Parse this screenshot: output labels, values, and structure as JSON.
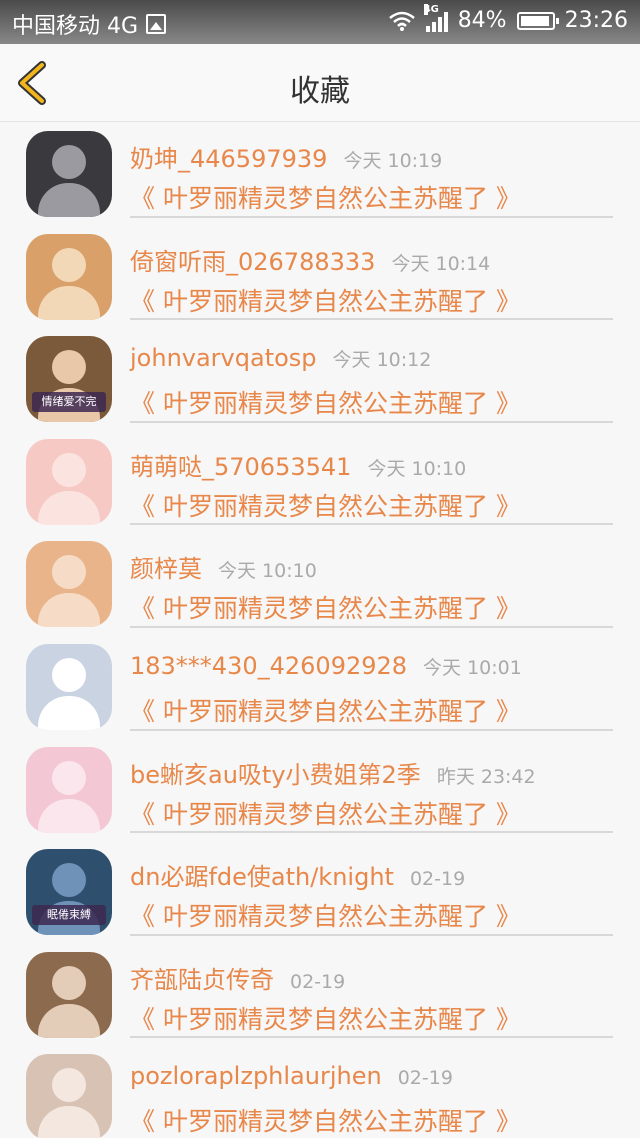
{
  "status_bar": {
    "carrier": "中国移动 4G",
    "network_badge": "4G",
    "battery": "84%",
    "time": "23:26"
  },
  "header": {
    "title": "收藏",
    "back_icon": "chevron-left-icon",
    "accent_color": "#f2b51c"
  },
  "colors": {
    "username": "#e8874a",
    "book_title": "#e8874a",
    "time": "#aaaaaa"
  },
  "favorites": [
    {
      "username": "奶坤_446597939",
      "time": "今天 10:19",
      "book": "《 叶罗丽精灵梦自然公主苏醒了 》",
      "avatar_bg": "#3a3a3e",
      "avatar_fg": "#9a9aa0",
      "avatar_text": ""
    },
    {
      "username": "倚窗听雨_026788333",
      "time": "今天 10:14",
      "book": "《 叶罗丽精灵梦自然公主苏醒了 》",
      "avatar_bg": "#d9a06a",
      "avatar_fg": "#f3d8b8",
      "avatar_text": ""
    },
    {
      "username": "johnvarvqatosp",
      "time": "今天 10:12",
      "book": "《 叶罗丽精灵梦自然公主苏醒了 》",
      "avatar_bg": "#7a5a3a",
      "avatar_fg": "#e8c8a8",
      "avatar_text": "情绪爱不完"
    },
    {
      "username": "萌萌哒_570653541",
      "time": "今天 10:10",
      "book": "《 叶罗丽精灵梦自然公主苏醒了 》",
      "avatar_bg": "#f7c9c4",
      "avatar_fg": "#fbe4e0",
      "avatar_text": ""
    },
    {
      "username": "颜梓莫",
      "time": "今天 10:10",
      "book": "《 叶罗丽精灵梦自然公主苏醒了 》",
      "avatar_bg": "#e9b48a",
      "avatar_fg": "#f6dcc6",
      "avatar_text": ""
    },
    {
      "username": "183***430_426092928",
      "time": "今天 10:01",
      "book": "《 叶罗丽精灵梦自然公主苏醒了 》",
      "avatar_bg": "#c9d3e2",
      "avatar_fg": "#ffffff",
      "avatar_text": ""
    },
    {
      "username": "be蜥亥au吸ty小费姐第2季",
      "time": "昨天 23:42",
      "book": "《 叶罗丽精灵梦自然公主苏醒了 》",
      "avatar_bg": "#f3c7d4",
      "avatar_fg": "#fbe6ee",
      "avatar_text": ""
    },
    {
      "username": "dn必踞fde使ath/knight",
      "time": "02-19",
      "book": "《 叶罗丽精灵梦自然公主苏醒了 》",
      "avatar_bg": "#2f4f6e",
      "avatar_fg": "#6f93b8",
      "avatar_text": "眠倦束縛"
    },
    {
      "username": "齐瓿陆贞传奇",
      "time": "02-19",
      "book": "《 叶罗丽精灵梦自然公主苏醒了 》",
      "avatar_bg": "#8c6a4e",
      "avatar_fg": "#e3cdb8",
      "avatar_text": ""
    },
    {
      "username": "pozloraplzphlaurjhen",
      "time": "02-19",
      "book": "《 叶罗丽精灵梦自然公主苏醒了 》",
      "avatar_bg": "#d8c2b4",
      "avatar_fg": "#f4e7e0",
      "avatar_text": ""
    }
  ]
}
